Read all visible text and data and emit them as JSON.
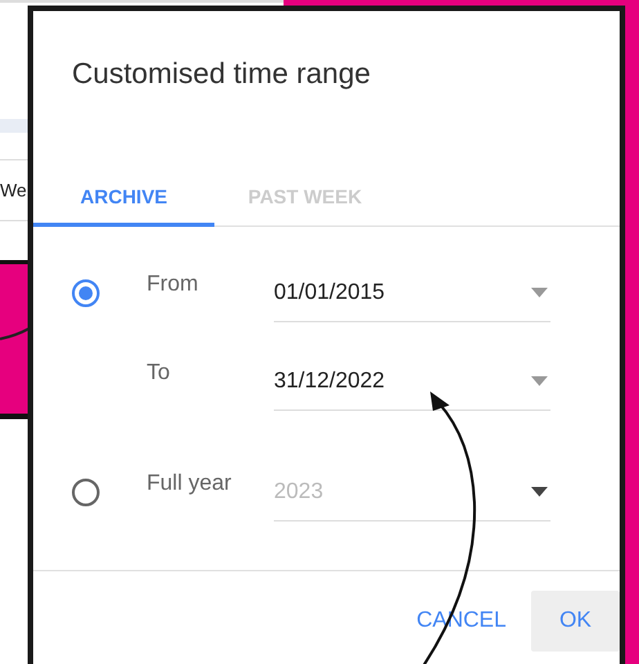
{
  "background": {
    "text": "We"
  },
  "dialog": {
    "title": "Customised time range",
    "tabs": [
      {
        "label": "ARCHIVE",
        "selected": true
      },
      {
        "label": "PAST WEEK",
        "selected": false
      }
    ],
    "options": [
      {
        "selected": true,
        "rows": [
          {
            "label": "From",
            "value": "01/01/2015",
            "disabled": false
          },
          {
            "label": "To",
            "value": "31/12/2022",
            "disabled": false
          }
        ]
      },
      {
        "selected": false,
        "rows": [
          {
            "label": "Full year",
            "value": "2023",
            "disabled": true
          }
        ]
      }
    ],
    "buttons": [
      {
        "label": "CANCEL",
        "kind": "text"
      },
      {
        "label": "OK",
        "kind": "filled"
      }
    ]
  }
}
